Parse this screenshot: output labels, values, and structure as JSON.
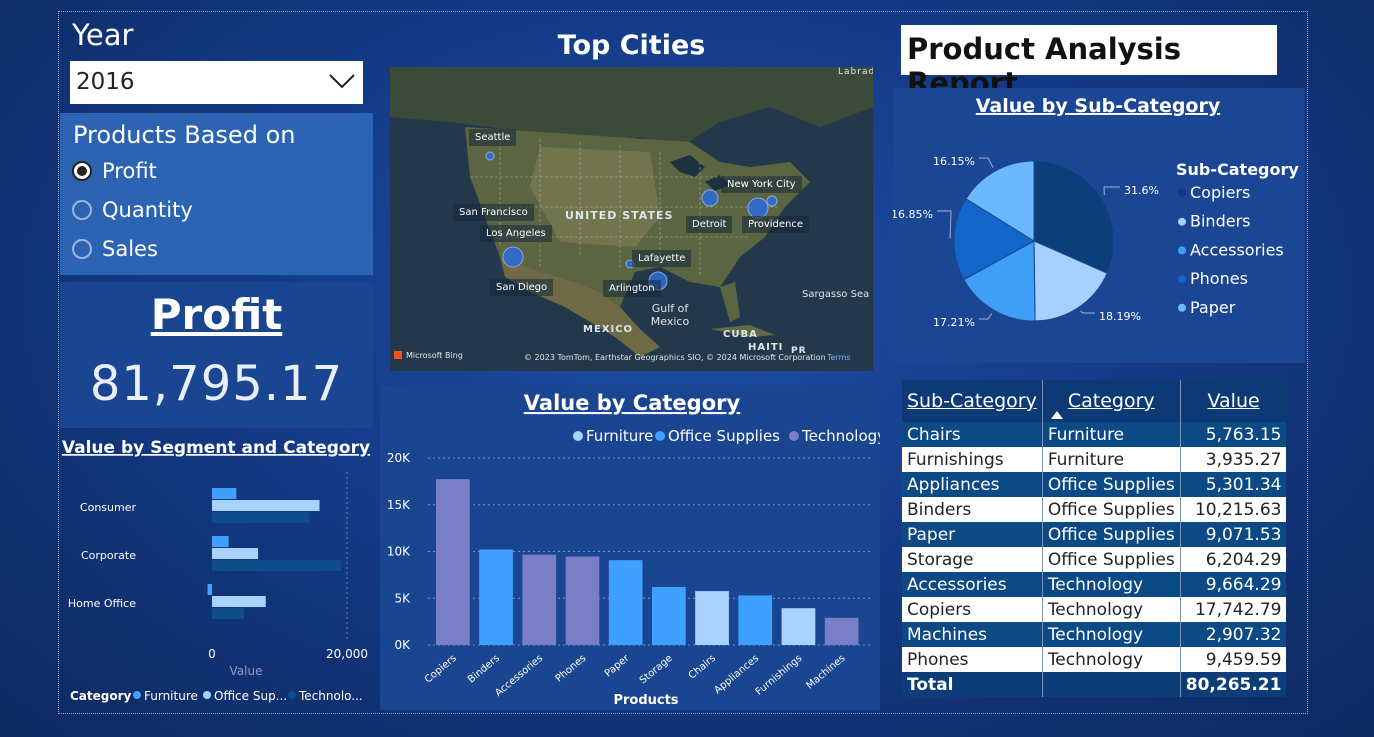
{
  "year_slicer": {
    "label": "Year",
    "selected": "2016"
  },
  "products_slicer": {
    "title": "Products Based on",
    "options": [
      "Profit",
      "Quantity",
      "Sales"
    ],
    "selected": "Profit"
  },
  "kpi": {
    "title": "Profit",
    "value": "81,795.17"
  },
  "map": {
    "title": "Top Cities",
    "cities": [
      "Seattle",
      "San Francisco",
      "Los Angeles",
      "San Diego",
      "Lafayette",
      "Arlington",
      "Detroit",
      "New York City",
      "Providence"
    ],
    "labels": [
      "UNITED STATES",
      "MEXICO",
      "Gulf of Mexico",
      "Sargasso Sea",
      "CUBA",
      "HAITI",
      "PR",
      "Labrado"
    ],
    "attribution": "© 2023 TomTom, Earthstar Geographics SIO, © 2024 Microsoft Corporation",
    "terms": "Terms",
    "brand": "Microsoft Bing"
  },
  "report": {
    "title": "Product Analysis Report"
  },
  "colors": {
    "furniture": "#3fa0ff",
    "office_supplies": "#a8d3ff",
    "technology": "#0f4c8c",
    "tech_bar": "#7a7ec6"
  },
  "chart_data": [
    {
      "type": "bar",
      "title": "Value by Segment and Category",
      "orientation": "horizontal",
      "categories": [
        "Consumer",
        "Corporate",
        "Home Office"
      ],
      "series": [
        {
          "name": "Furniture",
          "values": [
            3800,
            2600,
            -700
          ]
        },
        {
          "name": "Office Supplies",
          "values": [
            16800,
            7200,
            8400
          ]
        },
        {
          "name": "Technology",
          "values": [
            15200,
            20200,
            5000
          ]
        }
      ],
      "xlabel": "Value",
      "xticks": [
        "0",
        "20,000"
      ],
      "xlim": [
        -1000,
        21000
      ],
      "legend_title": "Category",
      "legend_labels": [
        "Furniture",
        "Office Sup...",
        "Technolo..."
      ]
    },
    {
      "type": "bar",
      "title": "Value by Category",
      "categories": [
        "Copiers",
        "Binders",
        "Accessories",
        "Phones",
        "Paper",
        "Storage",
        "Chairs",
        "Appliances",
        "Furnishings",
        "Machines"
      ],
      "values": [
        17742.79,
        10215.63,
        9664.29,
        9459.59,
        9071.53,
        6204.29,
        5763.15,
        5301.34,
        3935.27,
        2907.32
      ],
      "category_group": [
        "Technology",
        "Office Supplies",
        "Technology",
        "Technology",
        "Office Supplies",
        "Office Supplies",
        "Furniture",
        "Office Supplies",
        "Furniture",
        "Technology"
      ],
      "legend": [
        "Furniture",
        "Office Supplies",
        "Technology"
      ],
      "xlabel": "Products",
      "ylabel": "",
      "yticks": [
        "0K",
        "5K",
        "10K",
        "15K",
        "20K"
      ],
      "ylim": [
        0,
        20000
      ],
      "grid": true
    },
    {
      "type": "pie",
      "title": "Value by Sub-Category",
      "legend_title": "Sub-Category",
      "labels": [
        "Copiers",
        "Binders",
        "Accessories",
        "Phones",
        "Paper"
      ],
      "values": [
        31.6,
        18.19,
        17.21,
        16.85,
        16.15
      ],
      "value_labels": [
        "31.6%",
        "18.19%",
        "17.21%",
        "16.85%",
        "16.15%"
      ]
    }
  ],
  "table": {
    "headers": [
      "Sub-Category",
      "Category",
      "Value"
    ],
    "rows": [
      [
        "Chairs",
        "Furniture",
        "5,763.15"
      ],
      [
        "Furnishings",
        "Furniture",
        "3,935.27"
      ],
      [
        "Appliances",
        "Office Supplies",
        "5,301.34"
      ],
      [
        "Binders",
        "Office Supplies",
        "10,215.63"
      ],
      [
        "Paper",
        "Office Supplies",
        "9,071.53"
      ],
      [
        "Storage",
        "Office Supplies",
        "6,204.29"
      ],
      [
        "Accessories",
        "Technology",
        "9,664.29"
      ],
      [
        "Copiers",
        "Technology",
        "17,742.79"
      ],
      [
        "Machines",
        "Technology",
        "2,907.32"
      ],
      [
        "Phones",
        "Technology",
        "9,459.59"
      ]
    ],
    "total_label": "Total",
    "total_value": "80,265.21"
  }
}
